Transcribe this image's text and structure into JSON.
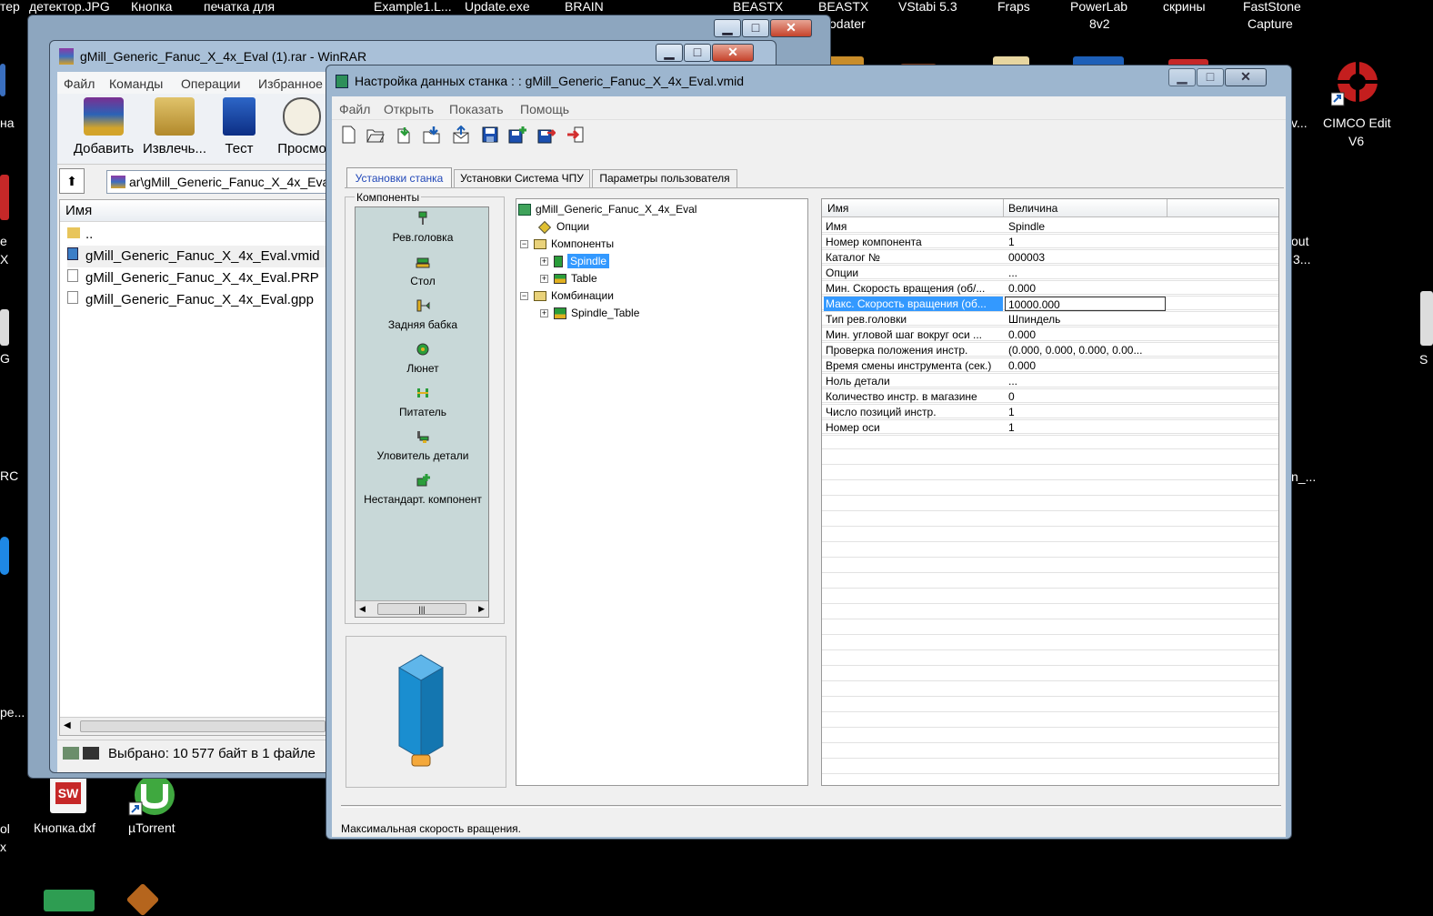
{
  "desktop": {
    "top_labels": [
      "тер",
      "детектор.JPG",
      "Кнопка",
      "печатка для",
      "Example1.L...",
      "Update.exe",
      "BRAIN",
      "BEASTX",
      "BEASTX",
      "odater",
      "VStabi 5.3",
      "Fraps",
      "PowerLab",
      "8v2",
      "скрины",
      "FastStone",
      "Capture"
    ],
    "right_icons": {
      "cimco_line1": "CIMCO Edit",
      "cimco_line2": "V6",
      "partial_v": "v...",
      "partial_out": "out",
      "partial_3": "3...",
      "partial_n": "n_...",
      "partial_s": "S"
    },
    "left_fragments": [
      "на",
      "е",
      "X",
      "G",
      "RC",
      "pe...",
      "ol",
      "x"
    ],
    "bottom_icons": {
      "knopka_dxf": "Кнопка.dxf",
      "utorrent": "µTorrent"
    }
  },
  "winrar": {
    "title": "gMill_Generic_Fanuc_X_4x_Eval (1).rar - WinRAR",
    "menu": [
      "Файл",
      "Команды",
      "Операции",
      "Избранное"
    ],
    "toolbar": [
      "Добавить",
      "Извлечь...",
      "Тест",
      "Просмо"
    ],
    "path": "ar\\gMill_Generic_Fanuc_X_4x_Eval",
    "column_name": "Имя",
    "files": [
      "..",
      "gMill_Generic_Fanuc_X_4x_Eval.vmid",
      "gMill_Generic_Fanuc_X_4x_Eval.PRP",
      "gMill_Generic_Fanuc_X_4x_Eval.gpp"
    ],
    "status": "Выбрано: 10 577 байт в 1 файле"
  },
  "dialog": {
    "title": "Настройка данных станка : : gMill_Generic_Fanuc_X_4x_Eval.vmid",
    "menu": [
      "Файл",
      "Открыть",
      "Показать",
      "Помощь"
    ],
    "tabs": [
      "Установки станка",
      "Установки Система ЧПУ",
      "Параметры пользователя"
    ],
    "components_group": "Компоненты",
    "components": [
      "Рев.головка",
      "Стол",
      "Задняя бабка",
      "Люнет",
      "Питатель",
      "Уловитель детали",
      "Нестандарт. компонент"
    ],
    "tree": {
      "root": "gMill_Generic_Fanuc_X_4x_Eval",
      "options": "Опции",
      "components": "Компоненты",
      "spindle": "Spindle",
      "table": "Table",
      "combinations": "Комбинации",
      "spindle_table": "Spindle_Table"
    },
    "grid": {
      "col_name": "Имя",
      "col_value": "Величина",
      "rows": [
        {
          "k": "Имя",
          "v": "Spindle"
        },
        {
          "k": "Номер компонента",
          "v": "1"
        },
        {
          "k": "Каталог №",
          "v": "000003"
        },
        {
          "k": "Опции",
          "v": "..."
        },
        {
          "k": "Мин. Скорость вращения (об/...",
          "v": "0.000"
        },
        {
          "k": "Макс. Скорость вращения (об...",
          "v": "10000.000"
        },
        {
          "k": "Тип рев.головки",
          "v": "Шпиндель"
        },
        {
          "k": "Мин. угловой шаг вокруг оси ...",
          "v": "0.000"
        },
        {
          "k": "Проверка положения инстр.",
          "v": "(0.000, 0.000, 0.000, 0.00..."
        },
        {
          "k": "Время смены инструмента (сек.)",
          "v": "0.000"
        },
        {
          "k": "Ноль детали",
          "v": "..."
        },
        {
          "k": "Количество инстр. в магазине",
          "v": "0"
        },
        {
          "k": "Число позиций инстр.",
          "v": "1"
        },
        {
          "k": "Номер оси",
          "v": "1"
        }
      ]
    },
    "status": "Максимальная скорость вращения."
  }
}
